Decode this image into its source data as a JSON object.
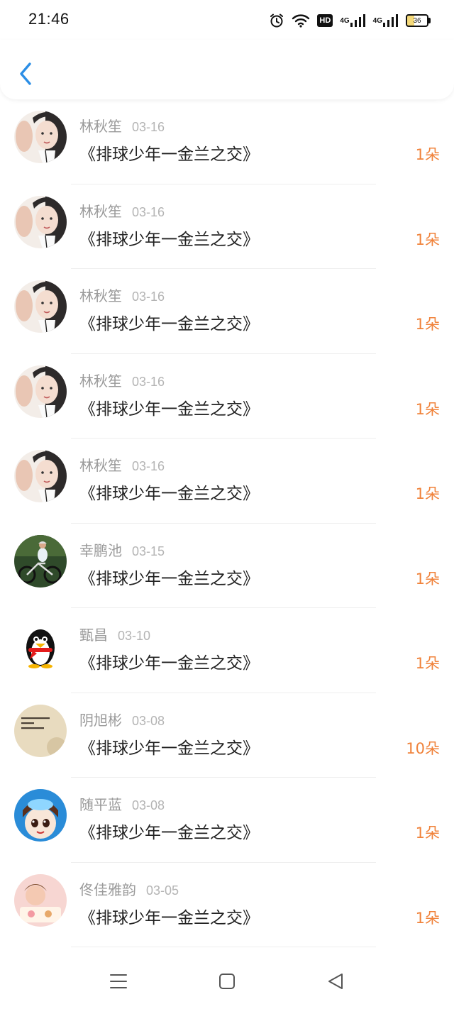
{
  "status_bar": {
    "time": "21:46",
    "hd_label": "HD",
    "signal_label": "4G",
    "battery": "36",
    "icons": [
      "alarm-icon",
      "wifi-icon",
      "hd-icon",
      "signal-4g-icon",
      "signal-4g-icon",
      "battery-icon"
    ]
  },
  "header": {
    "back_icon": "chevron-left-icon",
    "accent": "#2b8ee6"
  },
  "colors": {
    "amount": "#f0823a",
    "name": "#9a9a9a",
    "title": "#222222"
  },
  "items": [
    {
      "name": "林秋笙",
      "date": "03-16",
      "title": "《排球少年一金兰之交》",
      "amount": "1朵",
      "avatar": "girl-photo"
    },
    {
      "name": "林秋笙",
      "date": "03-16",
      "title": "《排球少年一金兰之交》",
      "amount": "1朵",
      "avatar": "girl-photo"
    },
    {
      "name": "林秋笙",
      "date": "03-16",
      "title": "《排球少年一金兰之交》",
      "amount": "1朵",
      "avatar": "girl-photo"
    },
    {
      "name": "林秋笙",
      "date": "03-16",
      "title": "《排球少年一金兰之交》",
      "amount": "1朵",
      "avatar": "girl-photo"
    },
    {
      "name": "林秋笙",
      "date": "03-16",
      "title": "《排球少年一金兰之交》",
      "amount": "1朵",
      "avatar": "girl-photo"
    },
    {
      "name": "幸鹏池",
      "date": "03-15",
      "title": "《排球少年一金兰之交》",
      "amount": "1朵",
      "avatar": "cyclist-photo"
    },
    {
      "name": "甄昌",
      "date": "03-10",
      "title": "《排球少年一金兰之交》",
      "amount": "1朵",
      "avatar": "penguin-icon"
    },
    {
      "name": "阴旭彬",
      "date": "03-08",
      "title": "《排球少年一金兰之交》",
      "amount": "10朵",
      "avatar": "paper-note-photo"
    },
    {
      "name": "随平蓝",
      "date": "03-08",
      "title": "《排球少年一金兰之交》",
      "amount": "1朵",
      "avatar": "cartoon-girl"
    },
    {
      "name": "佟佳雅韵",
      "date": "03-05",
      "title": "《排球少年一金兰之交》",
      "amount": "1朵",
      "avatar": "pink-illustration"
    }
  ],
  "nav": {
    "menu_icon": "menu-icon",
    "home_icon": "square-home-icon",
    "back_icon": "triangle-back-icon"
  }
}
